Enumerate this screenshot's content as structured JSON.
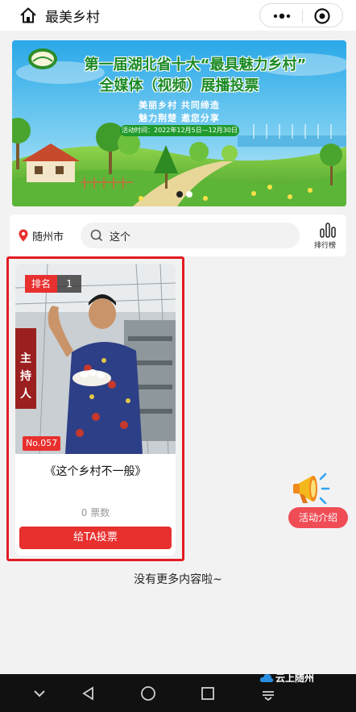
{
  "header": {
    "title": "最美乡村",
    "home_icon": "home-icon",
    "more_icon": "more-dots-icon",
    "close_icon": "target-close-icon"
  },
  "banner": {
    "logo_text": "最美乡村",
    "title_line1": "第一届湖北省十大“最具魅力乡村”",
    "title_line2": "全媒体（视频）展播投票",
    "slogan_line1": "美丽乡村 共同缔造",
    "slogan_line2": "魅力荆楚 邀您分享",
    "activity_time": "活动时间：2022年12月5日—12月30日",
    "carousel_active_index": 0,
    "carousel_count": 2,
    "colors": {
      "title": "#1c8a25",
      "time_bg": "#1f9a2c"
    }
  },
  "filters": {
    "city": "随州市",
    "search_value": "这个",
    "ranking_label": "排行榜"
  },
  "entries": [
    {
      "rank_label": "排名",
      "rank": "1",
      "number": "No.057",
      "photo_caption": "主持人",
      "title": "《这个乡村不一般》",
      "votes": "0 票数",
      "vote_button": "给TA投票"
    }
  ],
  "floating": {
    "activity_label": "活动介绍",
    "icon": "megaphone-icon"
  },
  "list_footer": "没有更多内容啦~",
  "watermark": "云上随州",
  "navbar": {
    "buttons": [
      "chevron-down-icon",
      "back-triangle-icon",
      "home-circle-icon",
      "recents-square-icon",
      "menu-lines-icon"
    ]
  },
  "colors": {
    "accent": "#e8302f",
    "highlight_border": "#e31b23",
    "page_bg": "#f2f2f2",
    "activity_pill": "#ef4c55"
  }
}
